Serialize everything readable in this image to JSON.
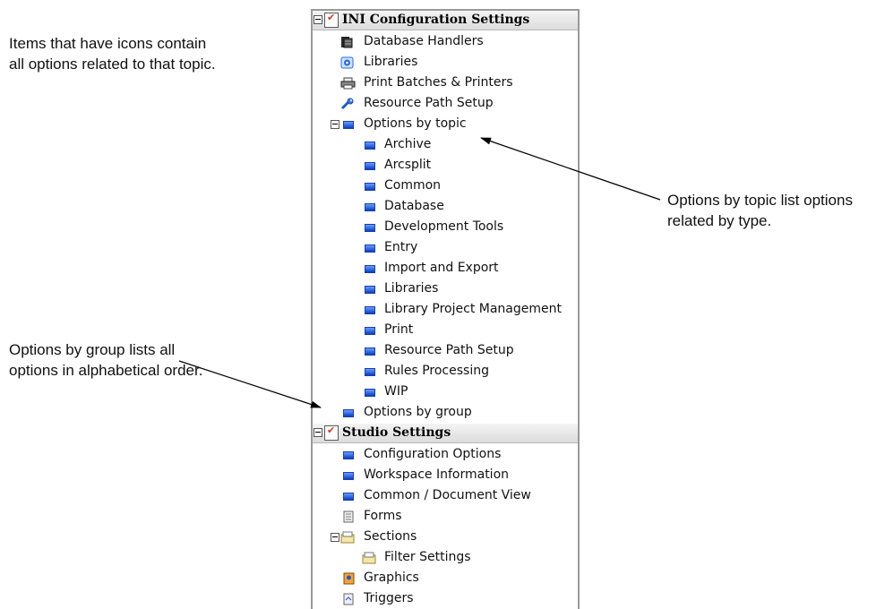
{
  "annotations": {
    "icons_note": [
      "Items that have icons contain",
      "all options related to that topic."
    ],
    "topic_note": [
      "Options by topic list options",
      "related by type."
    ],
    "group_note": [
      "Options by group lists all",
      "options in alphabetical order."
    ]
  },
  "ini_section": {
    "title": "INI Configuration Settings",
    "items": [
      {
        "label": "Database Handlers",
        "icon": "database-icon"
      },
      {
        "label": "Libraries",
        "icon": "library-icon"
      },
      {
        "label": "Print Batches & Printers",
        "icon": "printer-icon"
      },
      {
        "label": "Resource Path Setup",
        "icon": "wrench-icon"
      },
      {
        "label": "Options by topic",
        "icon": "folder-expanded-icon"
      }
    ],
    "topics": [
      "Archive",
      "Arcsplit",
      "Common",
      "Database",
      "Development Tools",
      "Entry",
      "Import and Export",
      "Libraries",
      "Library Project Management",
      "Print",
      "Resource Path Setup",
      "Rules Processing",
      "WIP"
    ],
    "group_item": "Options by group"
  },
  "studio_section": {
    "title": "Studio Settings",
    "items": [
      {
        "label": "Configuration Options",
        "icon": "bullet-icon"
      },
      {
        "label": "Workspace Information",
        "icon": "bullet-icon"
      },
      {
        "label": "Common / Document View",
        "icon": "bullet-icon"
      },
      {
        "label": "Forms",
        "icon": "form-icon"
      },
      {
        "label": "Sections",
        "icon": "section-icon"
      },
      {
        "label": "Filter Settings",
        "icon": "filter-icon"
      },
      {
        "label": "Graphics",
        "icon": "graphics-icon"
      },
      {
        "label": "Triggers",
        "icon": "trigger-icon"
      }
    ]
  },
  "colors": {
    "bullet": "#1a56d6",
    "check": "#d0342c",
    "header_bg": "#e4e4e4"
  }
}
